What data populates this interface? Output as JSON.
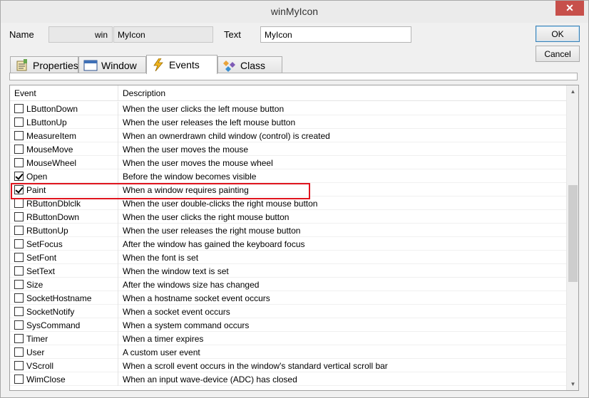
{
  "window": {
    "title": "winMyIcon",
    "close_symbol": "✕"
  },
  "form": {
    "name_label": "Name",
    "name_prefix": "win",
    "name_value": "MyIcon",
    "text_label": "Text",
    "text_value": "MyIcon",
    "ok_label": "OK",
    "cancel_label": "Cancel"
  },
  "tabs": [
    {
      "label": "Properties",
      "icon": "properties-icon"
    },
    {
      "label": "Window",
      "icon": "window-icon"
    },
    {
      "label": "Events",
      "icon": "lightning-icon",
      "active": true
    },
    {
      "label": "Class",
      "icon": "class-icon"
    }
  ],
  "grid": {
    "headers": {
      "event": "Event",
      "description": "Description"
    },
    "highlight_color": "#e0141e",
    "rows": [
      {
        "event": "LButtonDown",
        "checked": false,
        "description": "When the user clicks the left mouse button"
      },
      {
        "event": "LButtonUp",
        "checked": false,
        "description": "When the user releases the left mouse button"
      },
      {
        "event": "MeasureItem",
        "checked": false,
        "description": "When an ownerdrawn child window (control) is created"
      },
      {
        "event": "MouseMove",
        "checked": false,
        "description": "When the user moves the mouse"
      },
      {
        "event": "MouseWheel",
        "checked": false,
        "description": "When the user moves the mouse wheel"
      },
      {
        "event": "Open",
        "checked": true,
        "description": "Before the window becomes visible"
      },
      {
        "event": "Paint",
        "checked": true,
        "description": "When a window requires painting"
      },
      {
        "event": "RButtonDblclk",
        "checked": false,
        "description": "When the user double-clicks the right mouse button"
      },
      {
        "event": "RButtonDown",
        "checked": false,
        "description": "When the user clicks the right mouse button"
      },
      {
        "event": "RButtonUp",
        "checked": false,
        "description": "When the user releases the right mouse button"
      },
      {
        "event": "SetFocus",
        "checked": false,
        "description": "After the window has gained the keyboard focus"
      },
      {
        "event": "SetFont",
        "checked": false,
        "description": "When the font is set"
      },
      {
        "event": "SetText",
        "checked": false,
        "description": "When the window text is set"
      },
      {
        "event": "Size",
        "checked": false,
        "description": "After the windows size has changed"
      },
      {
        "event": "SocketHostname",
        "checked": false,
        "description": "When a hostname socket event occurs"
      },
      {
        "event": "SocketNotify",
        "checked": false,
        "description": "When a socket event occurs"
      },
      {
        "event": "SysCommand",
        "checked": false,
        "description": "When a system command occurs"
      },
      {
        "event": "Timer",
        "checked": false,
        "description": "When a timer expires"
      },
      {
        "event": "User",
        "checked": false,
        "description": "A custom user event"
      },
      {
        "event": "VScroll",
        "checked": false,
        "description": "When a scroll event occurs in the window's standard vertical scroll bar"
      },
      {
        "event": "WimClose",
        "checked": false,
        "description": "When an input wave-device (ADC) has closed"
      }
    ]
  }
}
